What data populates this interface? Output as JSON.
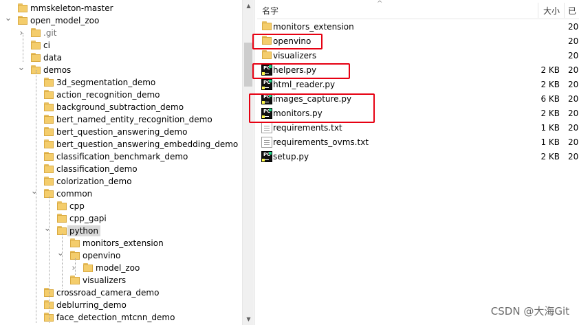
{
  "tree": {
    "rows": [
      {
        "label": "mmskeleton-master",
        "expander": "",
        "gray": false,
        "selected": false
      },
      {
        "label": "open_model_zoo",
        "expander": "expanded",
        "gray": false,
        "selected": false
      },
      {
        "label": ".git",
        "expander": "collapsed",
        "gray": true,
        "selected": false
      },
      {
        "label": "ci",
        "expander": "",
        "gray": false,
        "selected": false
      },
      {
        "label": "data",
        "expander": "",
        "gray": false,
        "selected": false
      },
      {
        "label": "demos",
        "expander": "expanded",
        "gray": false,
        "selected": false
      },
      {
        "label": "3d_segmentation_demo",
        "expander": "",
        "gray": false,
        "selected": false
      },
      {
        "label": "action_recognition_demo",
        "expander": "",
        "gray": false,
        "selected": false
      },
      {
        "label": "background_subtraction_demo",
        "expander": "",
        "gray": false,
        "selected": false
      },
      {
        "label": "bert_named_entity_recognition_demo",
        "expander": "",
        "gray": false,
        "selected": false
      },
      {
        "label": "bert_question_answering_demo",
        "expander": "",
        "gray": false,
        "selected": false
      },
      {
        "label": "bert_question_answering_embedding_demo",
        "expander": "",
        "gray": false,
        "selected": false
      },
      {
        "label": "classification_benchmark_demo",
        "expander": "",
        "gray": false,
        "selected": false
      },
      {
        "label": "classification_demo",
        "expander": "",
        "gray": false,
        "selected": false
      },
      {
        "label": "colorization_demo",
        "expander": "",
        "gray": false,
        "selected": false
      },
      {
        "label": "common",
        "expander": "expanded",
        "gray": false,
        "selected": false
      },
      {
        "label": "cpp",
        "expander": "",
        "gray": false,
        "selected": false
      },
      {
        "label": "cpp_gapi",
        "expander": "",
        "gray": false,
        "selected": false
      },
      {
        "label": "python",
        "expander": "expanded",
        "gray": false,
        "selected": true
      },
      {
        "label": "monitors_extension",
        "expander": "",
        "gray": false,
        "selected": false
      },
      {
        "label": "openvino",
        "expander": "expanded",
        "gray": false,
        "selected": false
      },
      {
        "label": "model_zoo",
        "expander": "collapsed",
        "gray": false,
        "selected": false
      },
      {
        "label": "visualizers",
        "expander": "",
        "gray": false,
        "selected": false
      },
      {
        "label": "crossroad_camera_demo",
        "expander": "",
        "gray": false,
        "selected": false
      },
      {
        "label": "deblurring_demo",
        "expander": "",
        "gray": false,
        "selected": false
      },
      {
        "label": "face_detection_mtcnn_demo",
        "expander": "",
        "gray": false,
        "selected": false
      }
    ]
  },
  "list": {
    "columns": {
      "name": "名字",
      "size": "大小",
      "date": "已"
    },
    "files": [
      {
        "name": "monitors_extension",
        "type": "folder",
        "size": "",
        "date": "20"
      },
      {
        "name": "openvino",
        "type": "folder",
        "size": "",
        "date": "20"
      },
      {
        "name": "visualizers",
        "type": "folder",
        "size": "",
        "date": "20"
      },
      {
        "name": "helpers.py",
        "type": "py",
        "size": "2 KB",
        "date": "20"
      },
      {
        "name": "html_reader.py",
        "type": "py",
        "size": "2 KB",
        "date": "20"
      },
      {
        "name": "images_capture.py",
        "type": "py",
        "size": "6 KB",
        "date": "20"
      },
      {
        "name": "monitors.py",
        "type": "py",
        "size": "2 KB",
        "date": "20"
      },
      {
        "name": "requirements.txt",
        "type": "txt",
        "size": "1 KB",
        "date": "20"
      },
      {
        "name": "requirements_ovms.txt",
        "type": "txt",
        "size": "1 KB",
        "date": "20"
      },
      {
        "name": "setup.py",
        "type": "py",
        "size": "2 KB",
        "date": "20"
      }
    ]
  },
  "icons": {
    "pycharm_label": "PC"
  },
  "annotation_color": "#e60012",
  "watermark": "CSDN @大海Git"
}
